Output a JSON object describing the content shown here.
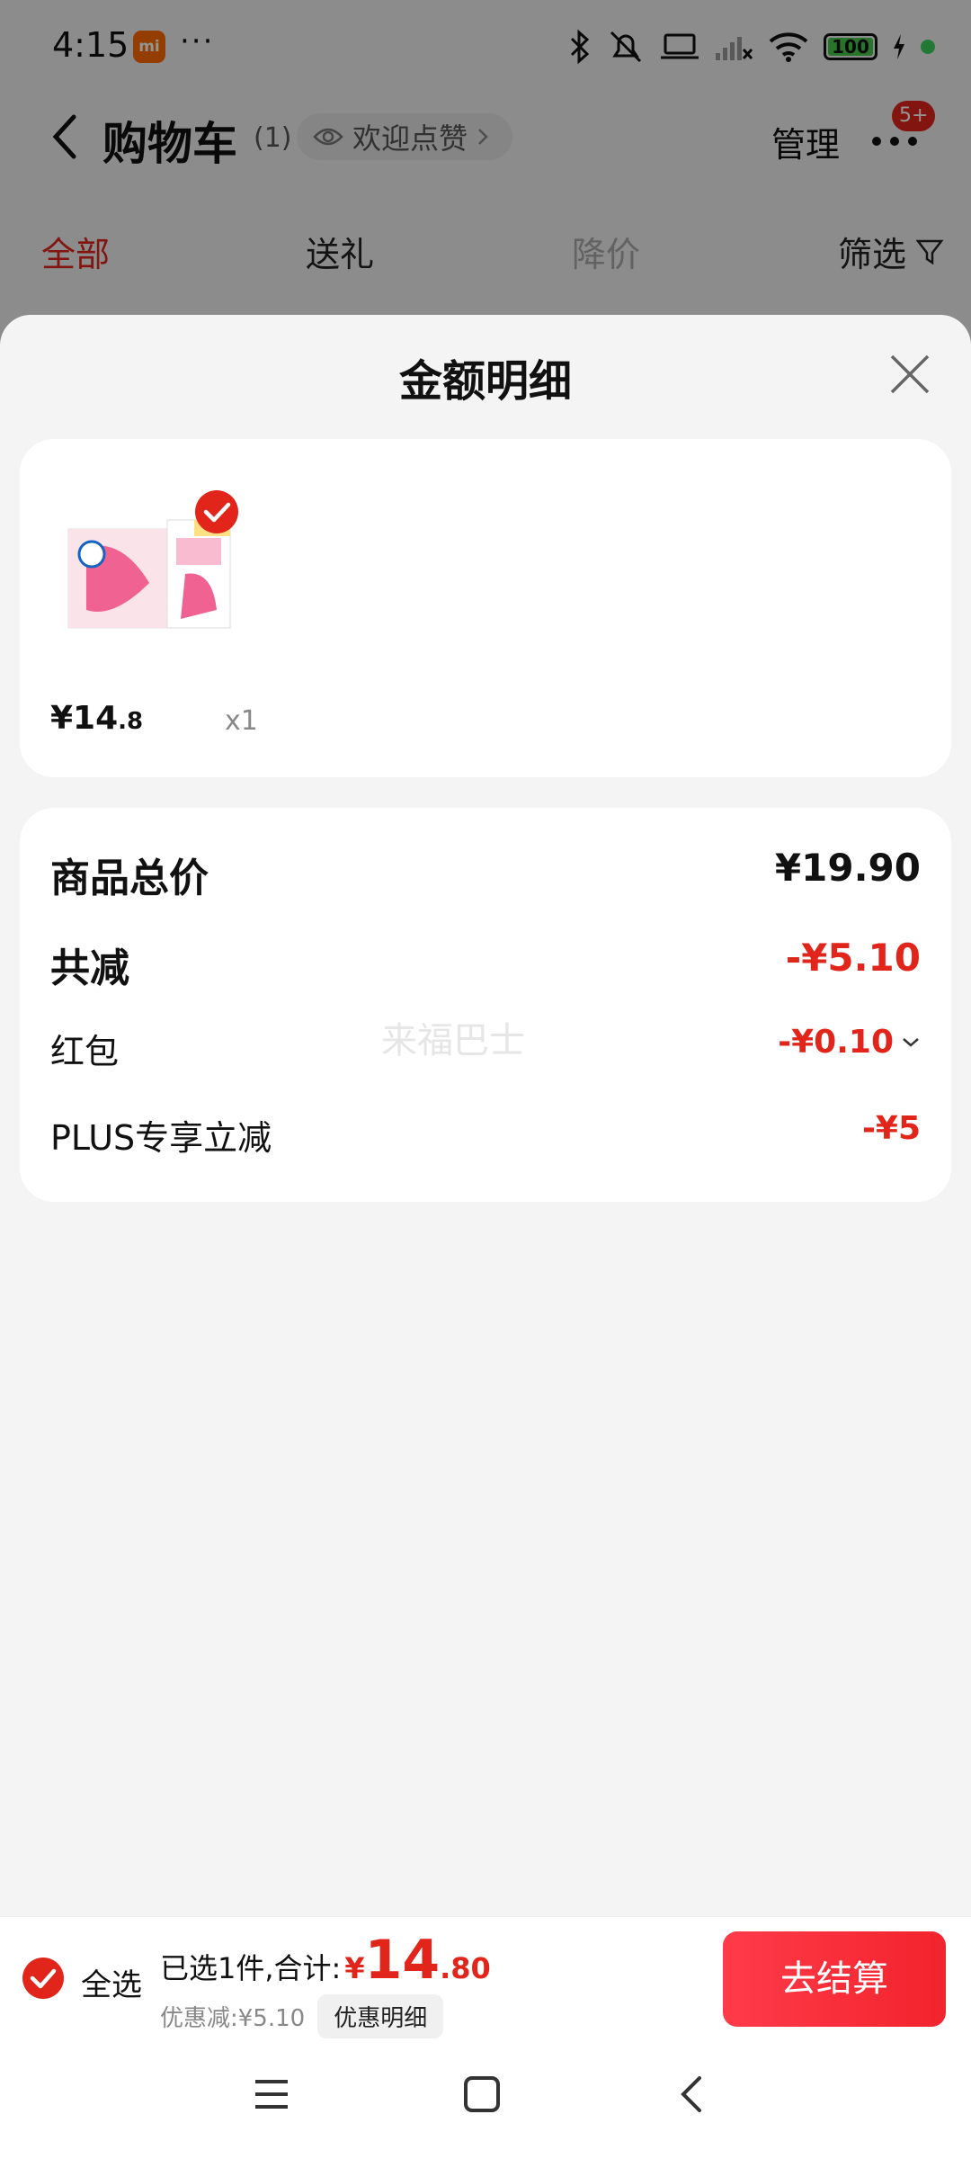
{
  "status_bar": {
    "time": "4:15",
    "mi_badge": "mi",
    "more": "···",
    "battery": "100"
  },
  "navbar": {
    "title": "购物车",
    "count": "(1)",
    "pill_label": "欢迎点赞",
    "manage": "管理",
    "badge": "5+"
  },
  "tabs": {
    "all": "全部",
    "gift": "送礼",
    "price_drop": "降价",
    "filter": "筛选"
  },
  "sheet": {
    "title": "金额明细",
    "product": {
      "price_int": "¥14",
      "price_dec": ".8",
      "qty": "x1"
    },
    "summary": {
      "total_label": "商品总价",
      "total_value": "¥19.90",
      "reduce_label": "共减",
      "reduce_value": "-¥5.10",
      "redpacket_label": "红包",
      "redpacket_value": "-¥0.10",
      "plus_label": "PLUS专享立减",
      "plus_value": "-¥5"
    },
    "watermark": "来福巴士"
  },
  "checkout": {
    "select_all": "全选",
    "selected_text": "已选1件,合计:",
    "currency": "¥",
    "total_int": "14",
    "total_dec": ".80",
    "discount_text": "优惠减:¥5.10",
    "detail_button": "优惠明细",
    "pay_button": "去结算"
  },
  "colors": {
    "accent_red": "#e1251b",
    "button_red": "#f2232c"
  }
}
